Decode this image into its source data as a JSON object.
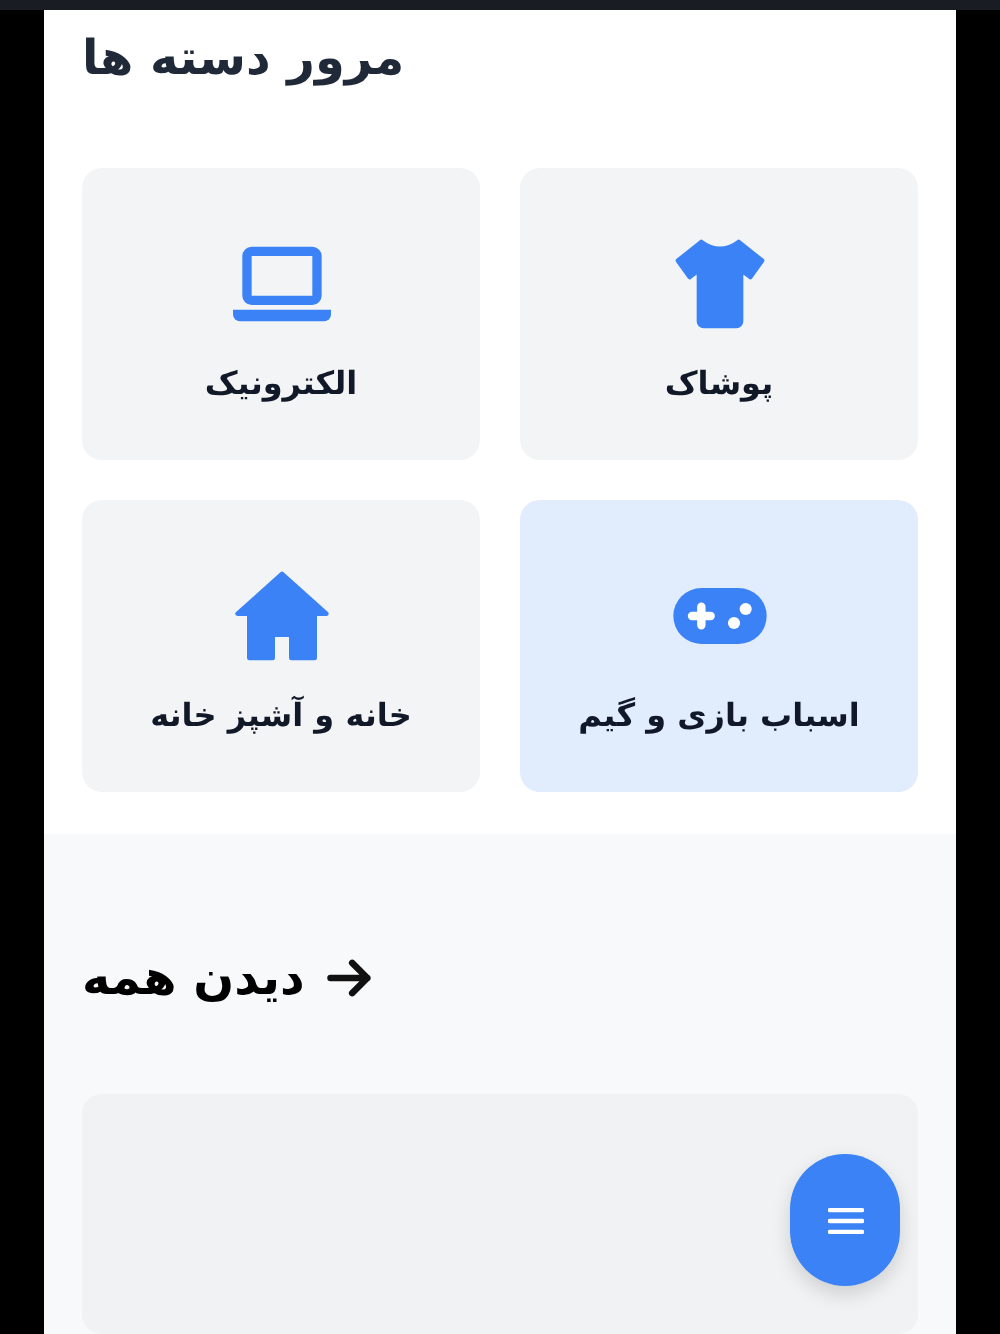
{
  "categories_section": {
    "title": "مرور دسته ها",
    "categories": [
      {
        "label": "پوشاک",
        "selected": false
      },
      {
        "label": "الکترونیک",
        "selected": false
      },
      {
        "label": "اسباب بازی و گیم",
        "selected": true
      },
      {
        "label": "خانه و آشپز خانه",
        "selected": false
      }
    ]
  },
  "products_section": {
    "link": "دیدن همه"
  }
}
